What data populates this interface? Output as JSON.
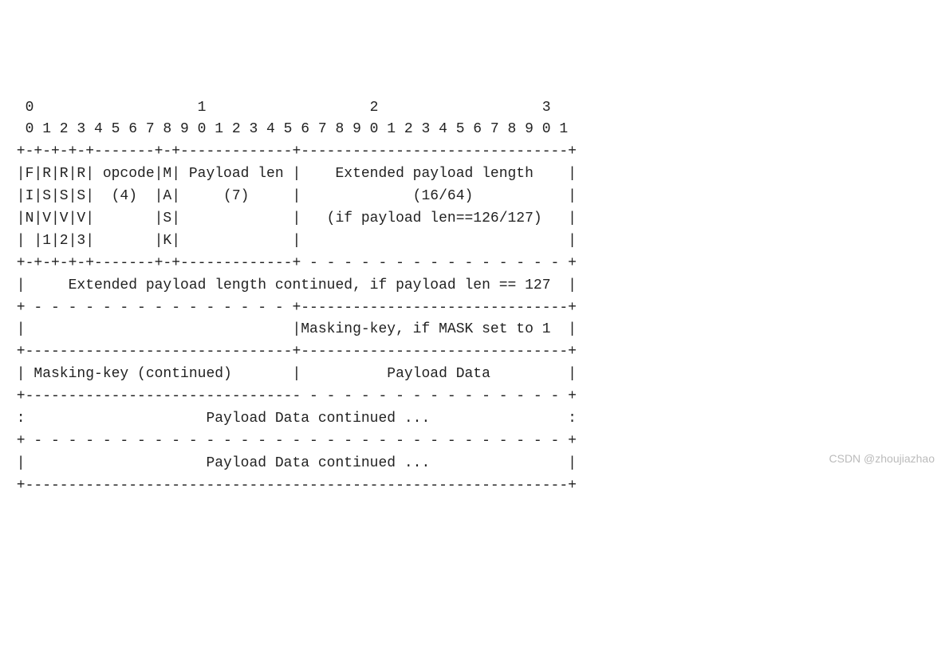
{
  "diagram": {
    "lines": [
      "  0                   1                   2                   3",
      "  0 1 2 3 4 5 6 7 8 9 0 1 2 3 4 5 6 7 8 9 0 1 2 3 4 5 6 7 8 9 0 1",
      " +-+-+-+-+-------+-+-------------+-------------------------------+",
      " |F|R|R|R| opcode|M| Payload len |    Extended payload length    |",
      " |I|S|S|S|  (4)  |A|     (7)     |             (16/64)           |",
      " |N|V|V|V|       |S|             |   (if payload len==126/127)   |",
      " | |1|2|3|       |K|             |                               |",
      " +-+-+-+-+-------+-+-------------+ - - - - - - - - - - - - - - - +",
      " |     Extended payload length continued, if payload len == 127  |",
      " + - - - - - - - - - - - - - - - +-------------------------------+",
      " |                               |Masking-key, if MASK set to 1  |",
      " +-------------------------------+-------------------------------+",
      " | Masking-key (continued)       |          Payload Data         |",
      " +-------------------------------- - - - - - - - - - - - - - - - +",
      " :                     Payload Data continued ...                :",
      " + - - - - - - - - - - - - - - - - - - - - - - - - - - - - - - - +",
      " |                     Payload Data continued ...                |",
      " +---------------------------------------------------------------+"
    ]
  },
  "fields": {
    "byte_markers": [
      "0",
      "1",
      "2",
      "3"
    ],
    "bit_positions": "0 1 2 3 4 5 6 7 8 9 0 1 2 3 4 5 6 7 8 9 0 1 2 3 4 5 6 7 8 9 0 1",
    "fin": "F I N",
    "rsv1": "R S V 1",
    "rsv2": "R S V 2",
    "rsv3": "R S V 3",
    "opcode_label": "opcode",
    "opcode_bits": "(4)",
    "mask_label": "M A S K",
    "payload_len_label": "Payload len",
    "payload_len_bits": "(7)",
    "ext_payload_label": "Extended payload length",
    "ext_payload_bits": "(16/64)",
    "ext_payload_cond": "(if payload len==126/127)",
    "ext_payload_cont": "Extended payload length continued, if payload len == 127",
    "masking_key_cond": "Masking-key, if MASK set to 1",
    "masking_key_cont": "Masking-key (continued)",
    "payload_data": "Payload Data",
    "payload_data_cont": "Payload Data continued ..."
  },
  "watermark": "CSDN @zhoujiazhao"
}
